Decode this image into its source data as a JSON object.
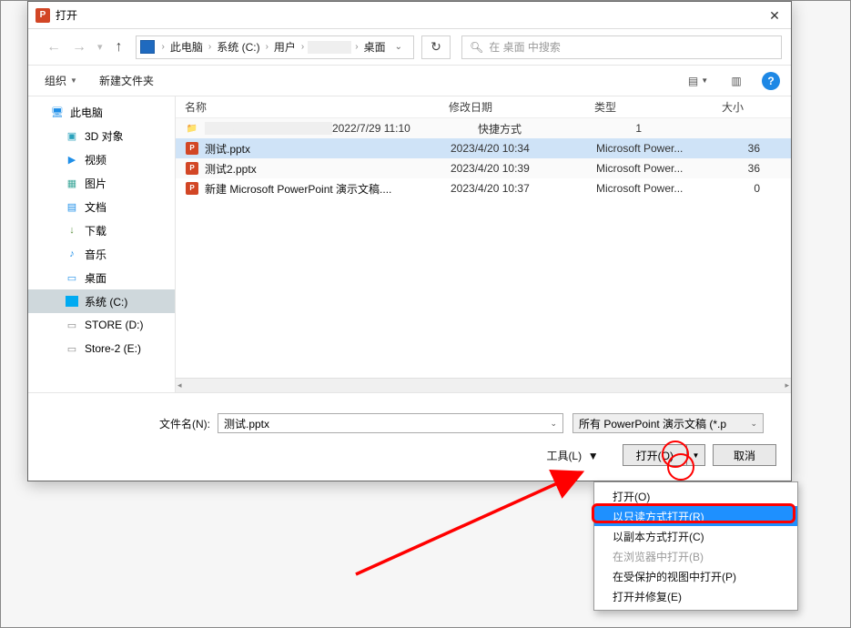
{
  "title": "打开",
  "breadcrumb": {
    "root": "此电脑",
    "drive": "系统 (C:)",
    "users": "用户",
    "desktop": "桌面"
  },
  "search": {
    "placeholder": "在 桌面 中搜索"
  },
  "toolbar": {
    "organize": "组织",
    "newfolder": "新建文件夹"
  },
  "sidebar": {
    "items": [
      {
        "label": "此电脑",
        "icon": "pc"
      },
      {
        "label": "3D 对象",
        "icon": "cube"
      },
      {
        "label": "视频",
        "icon": "video"
      },
      {
        "label": "图片",
        "icon": "pic"
      },
      {
        "label": "文档",
        "icon": "doc"
      },
      {
        "label": "下载",
        "icon": "dl"
      },
      {
        "label": "音乐",
        "icon": "music"
      },
      {
        "label": "桌面",
        "icon": "desk"
      },
      {
        "label": "系统 (C:)",
        "icon": "drive"
      },
      {
        "label": "STORE (D:)",
        "icon": "drive"
      },
      {
        "label": "Store-2 (E:)",
        "icon": "drive"
      }
    ]
  },
  "columns": {
    "name": "名称",
    "date": "修改日期",
    "type": "类型",
    "size": "大小"
  },
  "files": [
    {
      "name": "",
      "date": "2022/7/29 11:10",
      "type": "快捷方式",
      "size": "1",
      "icon": "folder",
      "blurred": true
    },
    {
      "name": "测试.pptx",
      "date": "2023/4/20 10:34",
      "type": "Microsoft Power...",
      "size": "36",
      "icon": "ppt",
      "selected": true
    },
    {
      "name": "测试2.pptx",
      "date": "2023/4/20 10:39",
      "type": "Microsoft Power...",
      "size": "36",
      "icon": "ppt"
    },
    {
      "name": "新建 Microsoft PowerPoint 演示文稿....",
      "date": "2023/4/20 10:37",
      "type": "Microsoft Power...",
      "size": "0",
      "icon": "ppt"
    }
  ],
  "footer": {
    "filename_label": "文件名(N):",
    "filename_value": "测试.pptx",
    "filter": "所有 PowerPoint 演示文稿 (*.p",
    "tools": "工具(L)",
    "open": "打开(O)",
    "cancel": "取消"
  },
  "menu": {
    "items": [
      {
        "label": "打开(O)"
      },
      {
        "label": "以只读方式打开(R)",
        "hl": true
      },
      {
        "label": "以副本方式打开(C)"
      },
      {
        "label": "在浏览器中打开(B)",
        "disabled": true
      },
      {
        "label": "在受保护的视图中打开(P)"
      },
      {
        "label": "打开并修复(E)"
      }
    ]
  }
}
